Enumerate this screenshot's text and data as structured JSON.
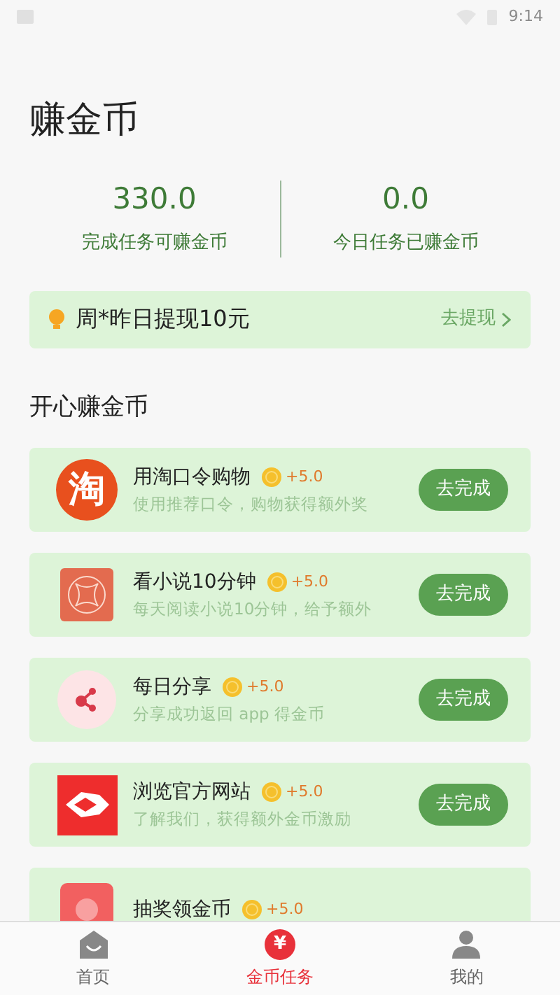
{
  "status_bar": {
    "time": "9:14"
  },
  "title": "赚金币",
  "stats": [
    {
      "value": "330.0",
      "label": "完成任务可赚金币"
    },
    {
      "value": "0.0",
      "label": "今日任务已赚金币"
    }
  ],
  "notice": {
    "text": "周*昨日提现10元",
    "action": "去提现"
  },
  "section_title": "开心赚金币",
  "tasks": [
    {
      "kind": "taobao",
      "icon_text": "淘",
      "title": "用淘口令购物",
      "reward": "+5.0",
      "description": "使用推荐口令，购物获得额外奖",
      "button": "去完成"
    },
    {
      "kind": "novel",
      "title": "看小说10分钟",
      "reward": "+5.0",
      "description": "每天阅读小说10分钟，给予额外",
      "button": "去完成"
    },
    {
      "kind": "share",
      "title": "每日分享",
      "reward": "+5.0",
      "description": "分享成功返回 app 得金币",
      "button": "去完成"
    },
    {
      "kind": "web",
      "title": "浏览官方网站",
      "reward": "+5.0",
      "description": "了解我们，获得额外金币激励",
      "button": "去完成"
    },
    {
      "kind": "lottery",
      "title": "抽奖领金币",
      "reward": "+5.0"
    }
  ],
  "nav": [
    {
      "kind": "home",
      "label": "首页",
      "selected": false
    },
    {
      "kind": "coins",
      "icon_text": "¥",
      "label": "金币任务",
      "selected": true
    },
    {
      "kind": "profile",
      "label": "我的",
      "selected": false
    }
  ]
}
